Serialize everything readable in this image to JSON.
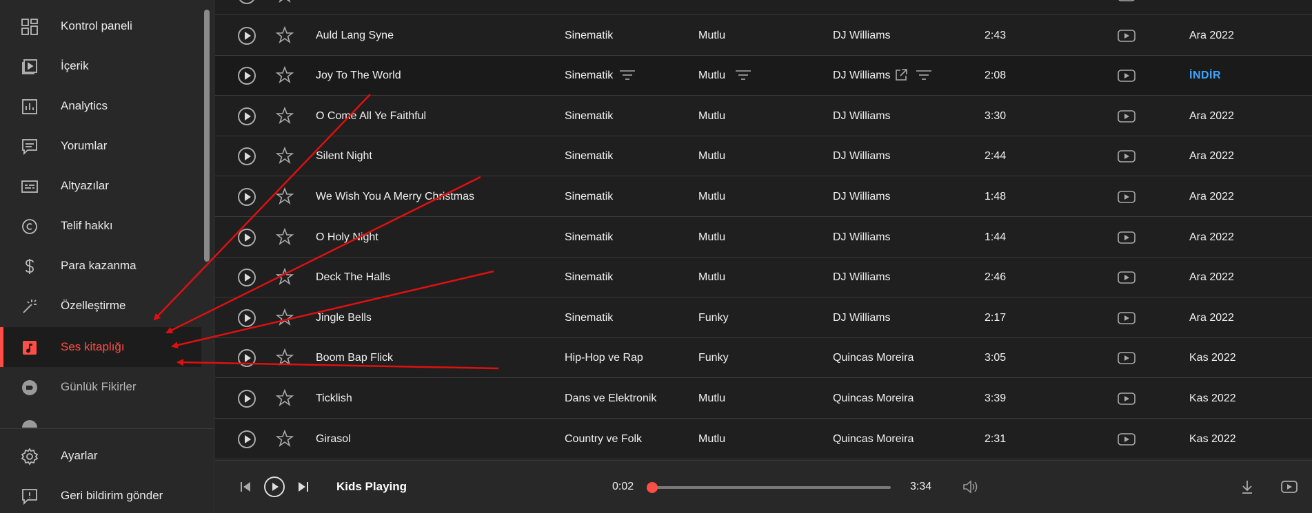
{
  "sidebar": {
    "items": [
      {
        "label": "Kontrol paneli",
        "icon": "dashboard-icon"
      },
      {
        "label": "İçerik",
        "icon": "content-icon"
      },
      {
        "label": "Analytics",
        "icon": "analytics-icon"
      },
      {
        "label": "Yorumlar",
        "icon": "comments-icon"
      },
      {
        "label": "Altyazılar",
        "icon": "subtitles-icon"
      },
      {
        "label": "Telif hakkı",
        "icon": "copyright-icon"
      },
      {
        "label": "Para kazanma",
        "icon": "dollar-icon"
      },
      {
        "label": "Özelleştirme",
        "icon": "magic-wand-icon"
      },
      {
        "label": "Ses kitaplığı",
        "icon": "audio-library-icon"
      },
      {
        "label": "Günlük Fikirler",
        "icon": "ideas-icon"
      },
      {
        "label": "Ayarlar",
        "icon": "gear-icon"
      },
      {
        "label": "Geri bildirim gönder",
        "icon": "feedback-icon"
      }
    ],
    "active_item": "Ses kitaplığı"
  },
  "table": {
    "rows": [
      {
        "title": "Auld Lang Syne",
        "genre": "Sinematik",
        "mood": "Mutlu",
        "artist": "DJ Williams",
        "duration": "2:43",
        "added": "Ara 2022"
      },
      {
        "title": "Joy To The World",
        "genre": "Sinematik",
        "mood": "Mutlu",
        "artist": "DJ Williams",
        "duration": "2:08",
        "added": "İNDİR"
      },
      {
        "title": "O Come All Ye Faithful",
        "genre": "Sinematik",
        "mood": "Mutlu",
        "artist": "DJ Williams",
        "duration": "3:30",
        "added": "Ara 2022"
      },
      {
        "title": "Silent Night",
        "genre": "Sinematik",
        "mood": "Mutlu",
        "artist": "DJ Williams",
        "duration": "2:44",
        "added": "Ara 2022"
      },
      {
        "title": "We Wish You A Merry Christmas",
        "genre": "Sinematik",
        "mood": "Mutlu",
        "artist": "DJ Williams",
        "duration": "1:48",
        "added": "Ara 2022"
      },
      {
        "title": "O Holy Night",
        "genre": "Sinematik",
        "mood": "Mutlu",
        "artist": "DJ Williams",
        "duration": "1:44",
        "added": "Ara 2022"
      },
      {
        "title": "Deck The Halls",
        "genre": "Sinematik",
        "mood": "Mutlu",
        "artist": "DJ Williams",
        "duration": "2:46",
        "added": "Ara 2022"
      },
      {
        "title": "Jingle Bells",
        "genre": "Sinematik",
        "mood": "Funky",
        "artist": "DJ Williams",
        "duration": "2:17",
        "added": "Ara 2022"
      },
      {
        "title": "Boom Bap Flick",
        "genre": "Hip-Hop ve Rap",
        "mood": "Funky",
        "artist": "Quincas Moreira",
        "duration": "3:05",
        "added": "Kas 2022"
      },
      {
        "title": "Ticklish",
        "genre": "Dans ve Elektronik",
        "mood": "Mutlu",
        "artist": "Quincas Moreira",
        "duration": "3:39",
        "added": "Kas 2022"
      },
      {
        "title": "Girasol",
        "genre": "Country ve Folk",
        "mood": "Mutlu",
        "artist": "Quincas Moreira",
        "duration": "2:31",
        "added": "Kas 2022"
      }
    ]
  },
  "player": {
    "track_title": "Kids Playing",
    "current_time": "0:02",
    "total_time": "3:34",
    "progress_fraction": 0.01
  },
  "colors": {
    "accent": "#ff4e45",
    "link": "#3ea6ff",
    "annotation_arrow": "#e01010"
  }
}
